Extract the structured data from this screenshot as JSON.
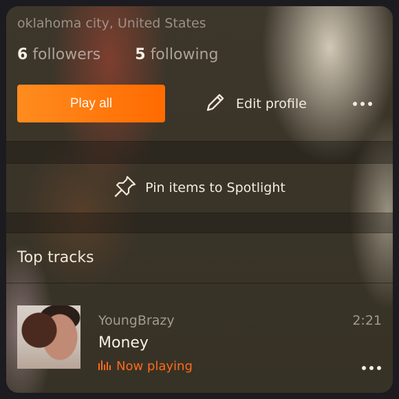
{
  "profile": {
    "location": "oklahoma city, United States",
    "followers_count": "6",
    "followers_label": "followers",
    "following_count": "5",
    "following_label": "following"
  },
  "actions": {
    "play_all_label": "Play all",
    "edit_profile_label": "Edit profile",
    "more_icon": "more-horizontal-icon"
  },
  "spotlight": {
    "label": "Pin items to Spotlight",
    "icon": "pin-icon"
  },
  "top_tracks": {
    "title": "Top tracks",
    "tracks": [
      {
        "artist": "YoungBrazy",
        "title": "Money",
        "duration": "2:21",
        "status": "Now playing"
      }
    ]
  },
  "colors": {
    "accent": "#ff6a1a",
    "button_gradient_start": "#ff8c1f",
    "button_gradient_end": "#ff6b00"
  }
}
